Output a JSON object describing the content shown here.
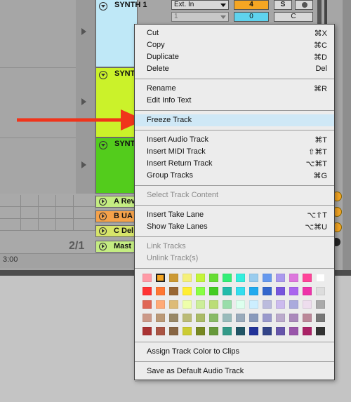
{
  "tracks": [
    {
      "name": "SYNTH 1",
      "color": "#bfe8f7"
    },
    {
      "name": "SYNTH",
      "color": "#cbf22a"
    },
    {
      "name": "SYNTH",
      "color": "#53cc1c"
    }
  ],
  "track_controls": {
    "input_type": "Ext. In",
    "input_channel": "1",
    "track_number": "4",
    "solo": "S",
    "volume": "0",
    "crossfade": "C"
  },
  "return_tracks": [
    {
      "name": "A Rev",
      "color": "#c4ec82"
    },
    {
      "name": "B UA",
      "color": "#f5a24a"
    },
    {
      "name": "C Del",
      "color": "#d7e56a"
    },
    {
      "name": "Mast",
      "color": "#c4ec82"
    }
  ],
  "position_label": "2/1",
  "time_label": "3:00",
  "context_menu": {
    "groups": [
      [
        {
          "label": "Cut",
          "shortcut": "⌘X"
        },
        {
          "label": "Copy",
          "shortcut": "⌘C"
        },
        {
          "label": "Duplicate",
          "shortcut": "⌘D"
        },
        {
          "label": "Delete",
          "shortcut": "Del"
        }
      ],
      [
        {
          "label": "Rename",
          "shortcut": "⌘R"
        },
        {
          "label": "Edit Info Text",
          "shortcut": ""
        }
      ],
      [
        {
          "label": "Freeze Track",
          "shortcut": ""
        }
      ],
      [
        {
          "label": "Insert Audio Track",
          "shortcut": "⌘T"
        },
        {
          "label": "Insert MIDI Track",
          "shortcut": "⇧⌘T"
        },
        {
          "label": "Insert Return Track",
          "shortcut": "⌥⌘T"
        },
        {
          "label": "Group Tracks",
          "shortcut": "⌘G"
        }
      ],
      [
        {
          "label": "Select Track Content",
          "shortcut": ""
        }
      ],
      [
        {
          "label": "Insert Take Lane",
          "shortcut": "⌥⇧T"
        },
        {
          "label": "Show Take Lanes",
          "shortcut": "⌥⌘U"
        }
      ],
      [
        {
          "label": "Link Tracks",
          "shortcut": ""
        },
        {
          "label": "Unlink Track(s)",
          "shortcut": ""
        }
      ],
      [
        {
          "label": "Assign Track Color to Clips",
          "shortcut": ""
        }
      ],
      [
        {
          "label": "Save as Default Audio Track",
          "shortcut": ""
        }
      ]
    ],
    "highlighted": "Freeze Track",
    "disabled": [
      "Select Track Content",
      "Link Tracks",
      "Unlink Track(s)"
    ]
  },
  "palette": [
    [
      "#ff9aa6",
      "#f5a623",
      "#cc9933",
      "#f5f07a",
      "#c3f53a",
      "#66dd33",
      "#33ee77",
      "#33eedd",
      "#99ccee",
      "#6699ee",
      "#aa99ee",
      "#dd77dd",
      "#ff4499",
      "#ffffff"
    ],
    [
      "#ff3333",
      "#ff7733",
      "#996633",
      "#ffee33",
      "#88ff44",
      "#44cc22",
      "#22bbaa",
      "#33ddee",
      "#22aaee",
      "#3366cc",
      "#7755dd",
      "#aa66ee",
      "#ee33aa",
      "#dddddd"
    ],
    [
      "#e06655",
      "#ffaa77",
      "#ddbb77",
      "#eeffaa",
      "#ccee99",
      "#bbdd77",
      "#99ddaa",
      "#ddffee",
      "#cceeff",
      "#bbbbdd",
      "#ccbbee",
      "#aaaadd",
      "#eeddee",
      "#aaaaaa"
    ],
    [
      "#cc9988",
      "#bb9977",
      "#998866",
      "#bbbb77",
      "#aabb66",
      "#88bb66",
      "#99bbbb",
      "#99aabb",
      "#8899bb",
      "#9999cc",
      "#bbaacc",
      "#aa88bb",
      "#bb8899",
      "#777777"
    ],
    [
      "#aa3333",
      "#aa5544",
      "#886644",
      "#cccc33",
      "#778822",
      "#66993a",
      "#339988",
      "#225566",
      "#223399",
      "#334488",
      "#6655aa",
      "#9955aa",
      "#aa2266",
      "#333333"
    ]
  ],
  "selected_swatch": "1"
}
